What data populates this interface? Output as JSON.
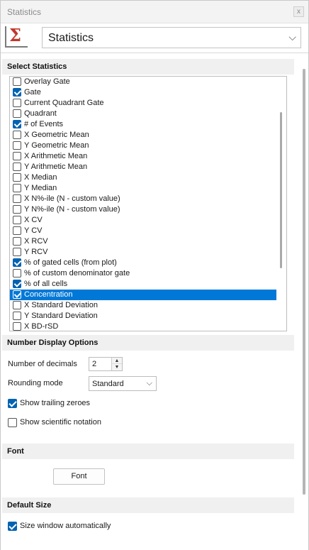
{
  "window": {
    "title": "Statistics",
    "close_glyph": "x"
  },
  "header": {
    "logo_glyph": "Σ",
    "view_value": "Statistics",
    "chevron": "⌵"
  },
  "sections": {
    "select_statistics": "Select Statistics",
    "number_display": "Number Display Options",
    "font": "Font",
    "default_size": "Default Size"
  },
  "statistics": [
    {
      "label": "Overlay Gate",
      "checked": false
    },
    {
      "label": "Gate",
      "checked": true
    },
    {
      "label": "Current Quadrant Gate",
      "checked": false
    },
    {
      "label": "Quadrant",
      "checked": false
    },
    {
      "label": "# of Events",
      "checked": true
    },
    {
      "label": "X Geometric Mean",
      "checked": false
    },
    {
      "label": "Y Geometric Mean",
      "checked": false
    },
    {
      "label": "X Arithmetic Mean",
      "checked": false
    },
    {
      "label": "Y Arithmetic Mean",
      "checked": false
    },
    {
      "label": "X Median",
      "checked": false
    },
    {
      "label": "Y Median",
      "checked": false
    },
    {
      "label": "X N%-ile (N - custom value)",
      "checked": false
    },
    {
      "label": "Y N%-ile (N - custom value)",
      "checked": false
    },
    {
      "label": "X CV",
      "checked": false
    },
    {
      "label": "Y CV",
      "checked": false
    },
    {
      "label": "X RCV",
      "checked": false
    },
    {
      "label": "Y RCV",
      "checked": false
    },
    {
      "label": "% of gated cells (from plot)",
      "checked": true
    },
    {
      "label": "% of custom denominator gate",
      "checked": false
    },
    {
      "label": "% of all cells",
      "checked": true
    },
    {
      "label": "Concentration",
      "checked": true,
      "selected": true
    },
    {
      "label": "X Standard Deviation",
      "checked": false
    },
    {
      "label": "Y Standard Deviation",
      "checked": false
    },
    {
      "label": "X BD-rSD",
      "checked": false
    }
  ],
  "number_display": {
    "decimals_label": "Number of decimals",
    "decimals_value": "2",
    "rounding_label": "Rounding mode",
    "rounding_value": "Standard",
    "show_trailing_zeroes": {
      "label": "Show trailing zeroes",
      "checked": true
    },
    "show_scientific": {
      "label": "Show scientific notation",
      "checked": false
    }
  },
  "font": {
    "button_label": "Font"
  },
  "default_size": {
    "size_auto": {
      "label": "Size window automatically",
      "checked": true
    }
  },
  "colors": {
    "accent": "#0078d7",
    "check_fill": "#0063b1",
    "logo_red": "#c0392b"
  }
}
